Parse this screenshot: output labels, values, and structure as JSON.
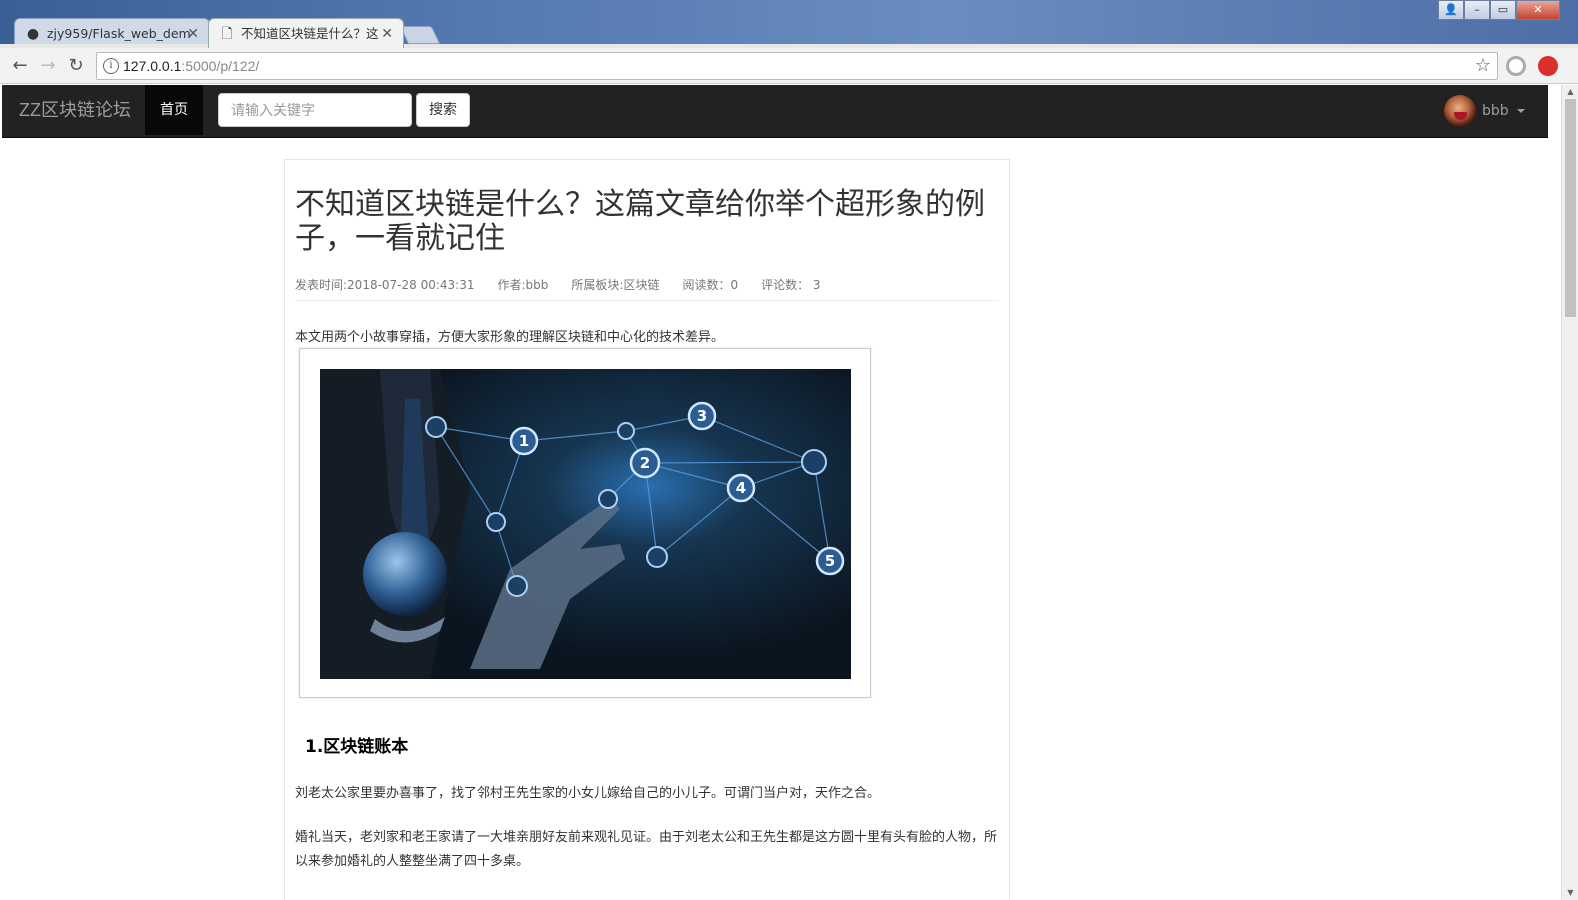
{
  "browser": {
    "tabs": [
      {
        "title": "zjy959/Flask_web_dem",
        "icon": "github-icon"
      },
      {
        "title": "不知道区块链是什么？这",
        "icon": "document-icon"
      }
    ],
    "url_host": "127.0.0.1",
    "url_path": ":5000/p/122/"
  },
  "navbar": {
    "brand": "ZZ区块链论坛",
    "home": "首页",
    "search_placeholder": "请输入关键字",
    "search_button": "搜索",
    "username": "bbb"
  },
  "article": {
    "title": "不知道区块链是什么？这篇文章给你举个超形象的例子，一看就记住",
    "meta": {
      "time": "发表时间:2018-07-28 00:43:31",
      "author": "作者:bbb",
      "board": "所属板块:区块链",
      "reads": "阅读数：0",
      "comments": "评论数： 3"
    },
    "intro": "本文用两个小故事穿插，方便大家形象的理解区块链和中心化的技术差异。",
    "image_nodes": [
      "1",
      "2",
      "3",
      "4",
      "5"
    ],
    "heading": "1.区块链账本",
    "paragraph1": "刘老太公家里要办喜事了，找了邻村王先生家的小女儿嫁给自己的小儿子。可谓门当户对，天作之合。",
    "paragraph2": "婚礼当天，老刘家和老王家请了一大堆亲朋好友前来观礼见证。由于刘老太公和王先生都是这方圆十里有头有脸的人物，所以来参加婚礼的人整整坐满了四十多桌。"
  }
}
